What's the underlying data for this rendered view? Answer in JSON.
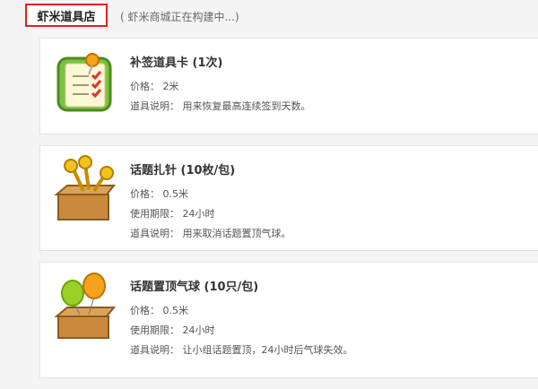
{
  "header": {
    "shop_title": "虾米道具店",
    "shop_note": "( 虾米商城正在构建中...)"
  },
  "items": [
    {
      "name": "补签道具卡 (1次)",
      "icon": "checklist-card-icon",
      "price_label": "价格：",
      "price": "2米",
      "desc_label": "道具说明：",
      "desc": "用来恢复最高连续签到天数。"
    },
    {
      "name": "话题扎针 (10枚/包)",
      "icon": "pins-box-icon",
      "price_label": "价格：",
      "price": "0.5米",
      "period_label": "使用期限：",
      "period": "24小时",
      "desc_label": "道具说明：",
      "desc": "用来取消话题置顶气球。"
    },
    {
      "name": "话题置顶气球 (10只/包)",
      "icon": "balloons-box-icon",
      "price_label": "价格：",
      "price": "0.5米",
      "period_label": "使用期限：",
      "period": "24小时",
      "desc_label": "道具说明：",
      "desc": "让小组话题置顶，24小时后气球失效。"
    }
  ]
}
